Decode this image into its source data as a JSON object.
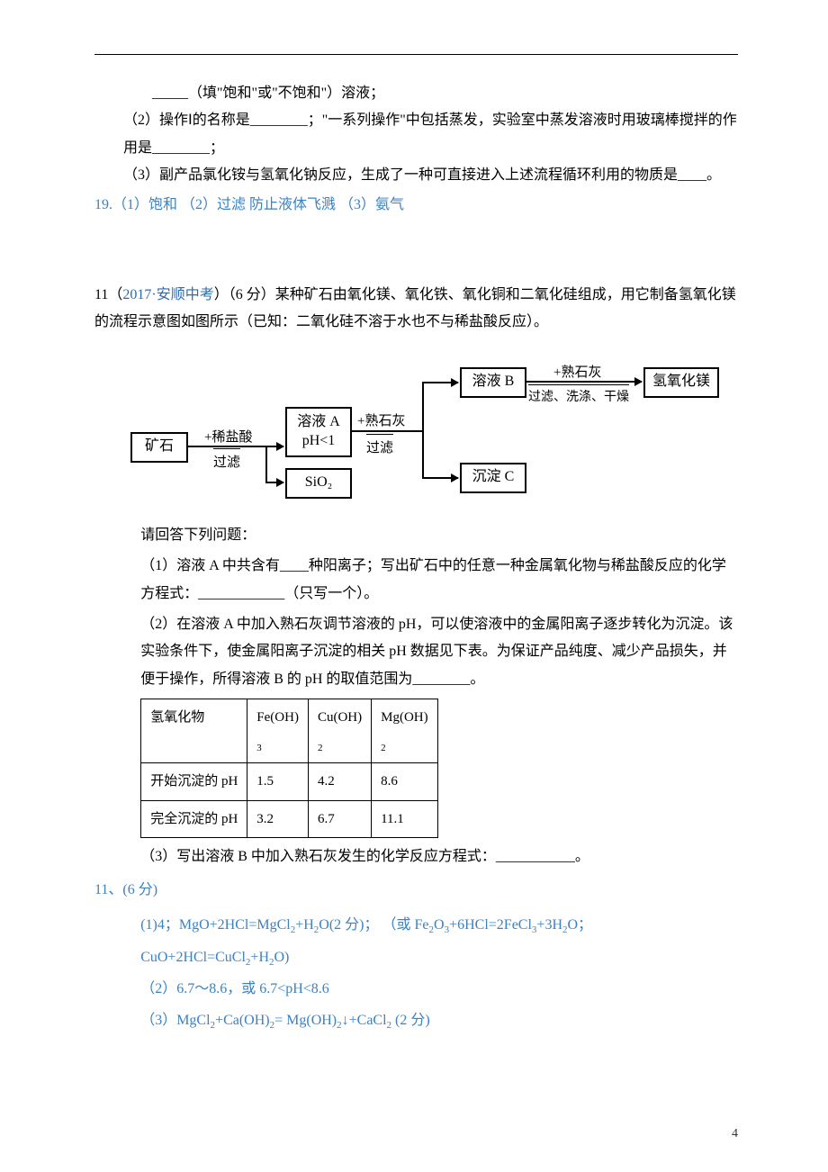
{
  "intro": {
    "line1_prefix": "_____（填\"饱和\"或\"不饱和\"）溶液；",
    "line2": "（2）操作Ⅰ的名称是________；\"一系列操作\"中包括蒸发，实验室中蒸发溶液时用玻璃棒搅拌的作用是________；",
    "line3": "（3）副产品氯化铵与氢氧化钠反应，生成了一种可直接进入上述流程循环利用的物质是____。"
  },
  "ans19": "19.（1）饱和 （2）过滤  防止液体飞溅 （3）氨气",
  "q11": {
    "header_a": "11（",
    "header_src": "2017·安顺中考",
    "header_b": "）（6 分）某种矿石由氧化镁、氧化铁、氧化铜和二氧化硅组成，用它制备氢氧化镁的流程示意图如图所示（已知：二氧化硅不溶于水也不与稀盐酸反应）。",
    "diagram": {
      "ore": "矿石",
      "hcl": "+稀盐酸",
      "filter": "过滤",
      "solA1": "溶液 A",
      "solA2": "pH<1",
      "sio2": "SiO₂",
      "lime": "+熟石灰",
      "solB": "溶液 B",
      "precC": "沉淀 C",
      "step3": "过滤、洗涤、干燥",
      "mgoh": "氢氧化镁"
    },
    "prompt": "请回答下列问题：",
    "p1": "（1）溶液 A 中共含有____种阳离子；写出矿石中的任意一种金属氧化物与稀盐酸反应的化学方程式：____________（只写一个）。",
    "p2": "（2）在溶液 A 中加入熟石灰调节溶液的 pH，可以使溶液中的金属阳离子逐步转化为沉淀。该实验条件下，使金属阳离子沉淀的相关 pH 数据见下表。为保证产品纯度、减少产品损失，并便于操作，所得溶液 B 的 pH 的取值范围为________。",
    "p3": "（3）写出溶液 B 中加入熟石灰发生的化学反应方程式：___________。"
  },
  "table": {
    "h": {
      "c0": "氢氧化物",
      "c1": "Fe(OH)",
      "c1s": "3",
      "c2": "Cu(OH)",
      "c2s": "2",
      "c3": "Mg(OH)",
      "c3s": "2"
    },
    "r1": {
      "c0": "开始沉淀的 pH",
      "c1": "1.5",
      "c2": "4.2",
      "c3": "8.6"
    },
    "r2": {
      "c0": "完全沉淀的 pH",
      "c1": "3.2",
      "c2": "6.7",
      "c3": "11.1"
    }
  },
  "ans11": {
    "head": "11、(6 分)",
    "l1a": "(1)4；MgO+2HCl=MgCl",
    "l1b": "+H",
    "l1c": "O(2 分)；",
    "l1d": "（或 Fe",
    "l1e": "O",
    "l1f": "+6HCl=2FeCl",
    "l1g": "+3H",
    "l1h": "O；CuO+2HCl=CuCl",
    "l1i": "+H",
    "l1j": "O)",
    "l2": "（2）6.7～8.6，或 6.7<pH<8.6",
    "l3a": "（3）MgCl",
    "l3b": "+Ca(OH)",
    "l3c": "= Mg(OH)",
    "l3d": "↓+CaCl",
    "l3e": "  (2 分)"
  },
  "footer": "4"
}
